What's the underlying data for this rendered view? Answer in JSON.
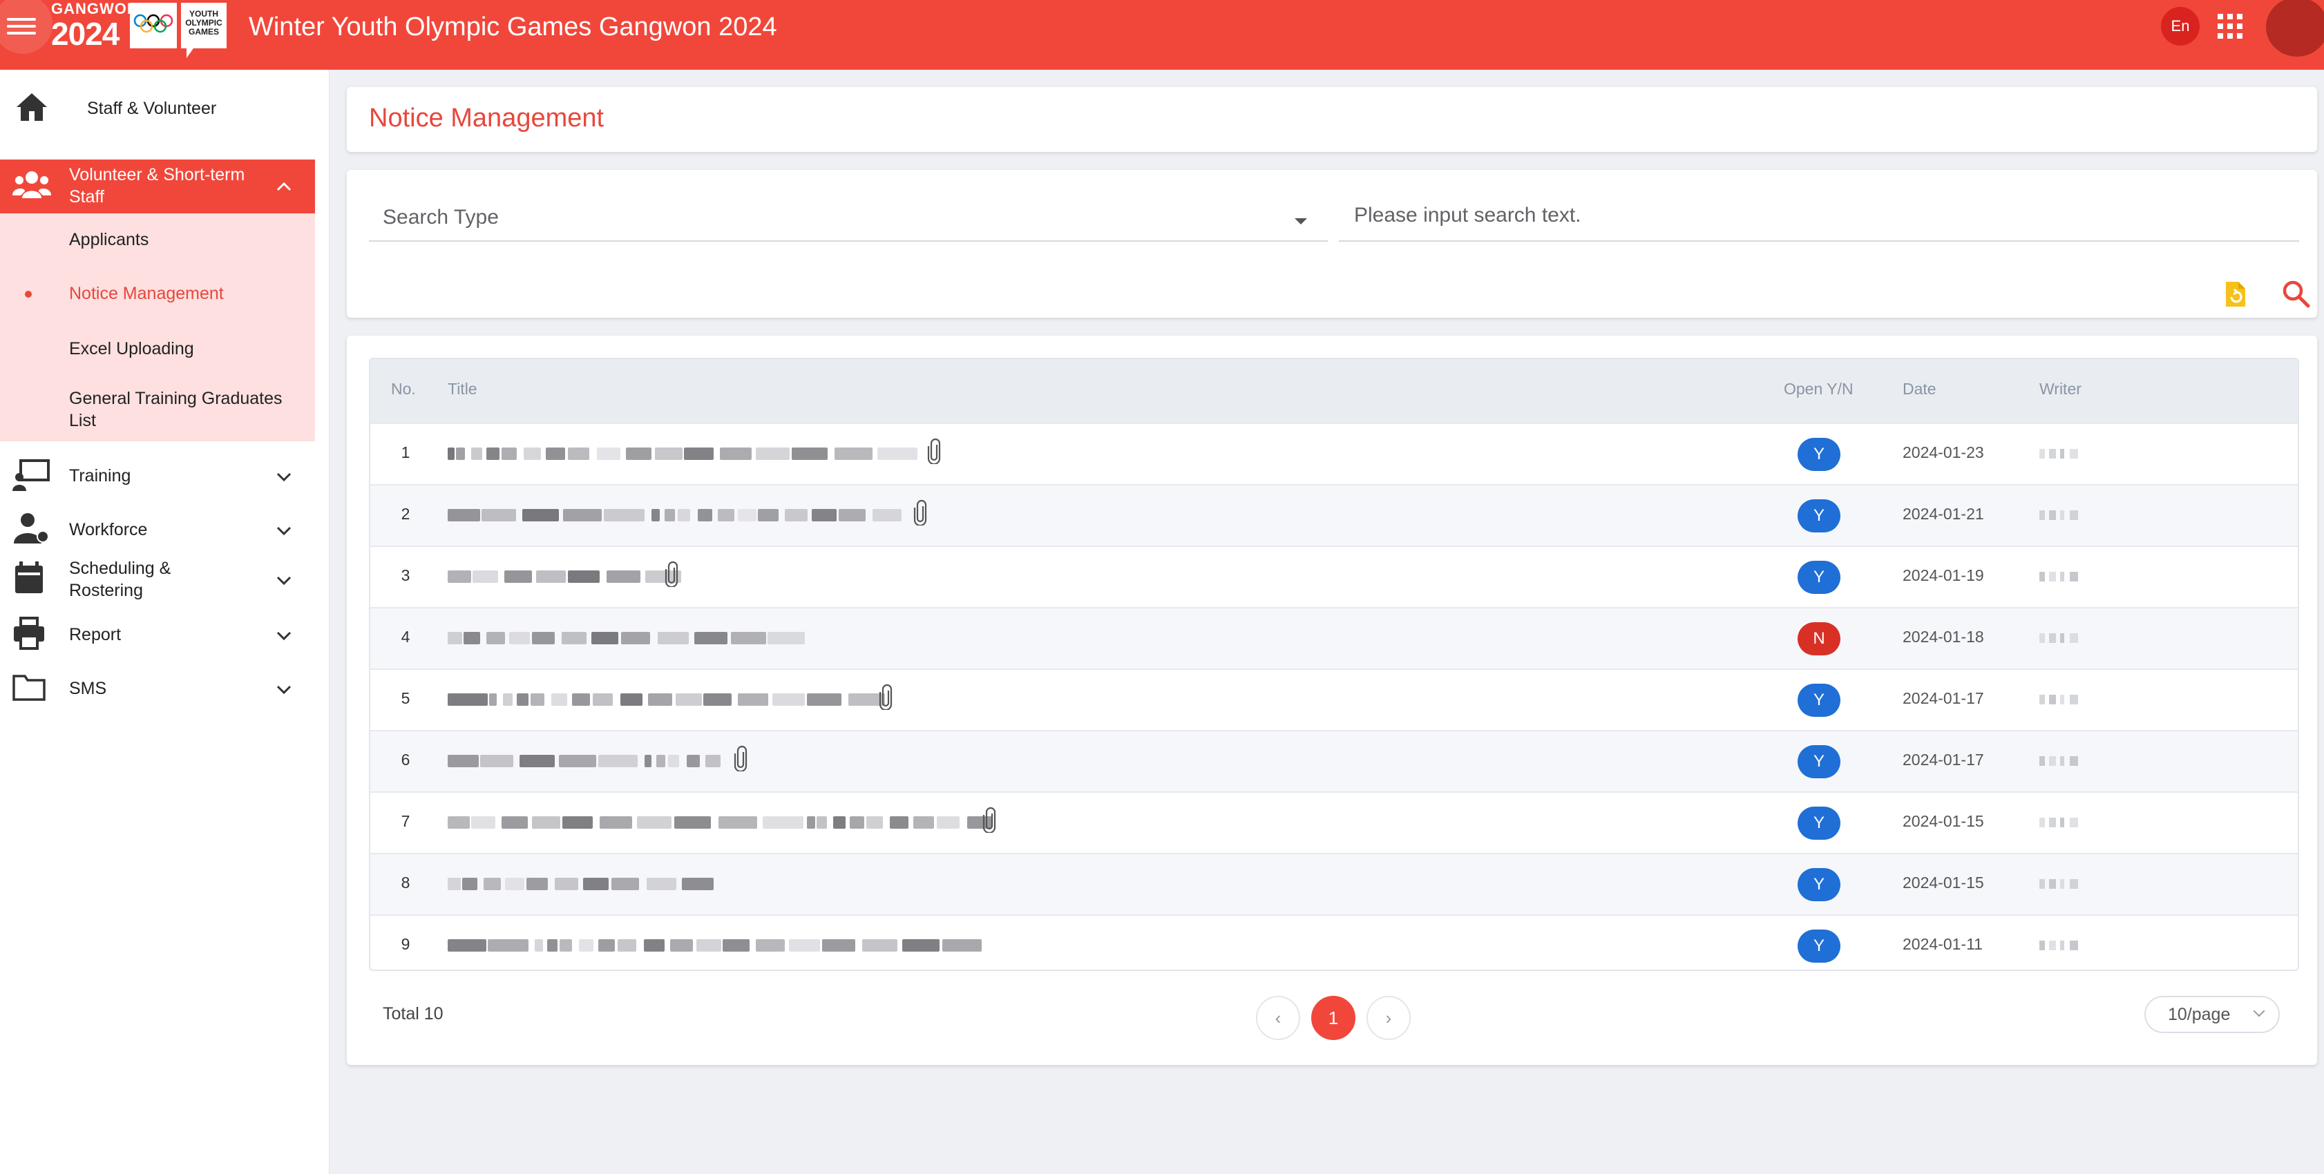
{
  "header": {
    "logo_line1": "GANGWON",
    "logo_line2": "2024",
    "yog_badge": "YOUTH OLYMPIC GAMES",
    "title": "Winter Youth Olympic Games Gangwon 2024",
    "lang": "En"
  },
  "sidebar": {
    "home_label": "Staff & Volunteer",
    "group_label": "Volunteer & Short-term Staff",
    "sub_items": [
      "Applicants",
      "Notice Management",
      "Excel Uploading",
      "General Training Graduates List"
    ],
    "items": [
      {
        "label": "Training"
      },
      {
        "label": "Workforce"
      },
      {
        "label": "Scheduling & Rostering"
      },
      {
        "label": "Report"
      },
      {
        "label": "SMS"
      }
    ]
  },
  "page": {
    "title": "Notice Management"
  },
  "search": {
    "type_placeholder": "Search Type",
    "text_placeholder": "Please input search text."
  },
  "table": {
    "headers": {
      "no": "No.",
      "title": "Title",
      "open": "Open Y/N",
      "date": "Date",
      "writer": "Writer"
    },
    "rows": [
      {
        "no": "1",
        "open": "Y",
        "date": "2024-01-23",
        "attachment": true
      },
      {
        "no": "2",
        "open": "Y",
        "date": "2024-01-21",
        "attachment": true
      },
      {
        "no": "3",
        "open": "Y",
        "date": "2024-01-19",
        "attachment": true
      },
      {
        "no": "4",
        "open": "N",
        "date": "2024-01-18",
        "attachment": false
      },
      {
        "no": "5",
        "open": "Y",
        "date": "2024-01-17",
        "attachment": true
      },
      {
        "no": "6",
        "open": "Y",
        "date": "2024-01-17",
        "attachment": true
      },
      {
        "no": "7",
        "open": "Y",
        "date": "2024-01-15",
        "attachment": true
      },
      {
        "no": "8",
        "open": "Y",
        "date": "2024-01-15",
        "attachment": false
      },
      {
        "no": "9",
        "open": "Y",
        "date": "2024-01-11",
        "attachment": false
      }
    ]
  },
  "pagination": {
    "total": "Total 10",
    "current_page": "1",
    "page_size": "10/page"
  },
  "colors": {
    "brand": "#f1473b",
    "open_yes": "#1f6fd6",
    "open_no": "#d93025"
  }
}
